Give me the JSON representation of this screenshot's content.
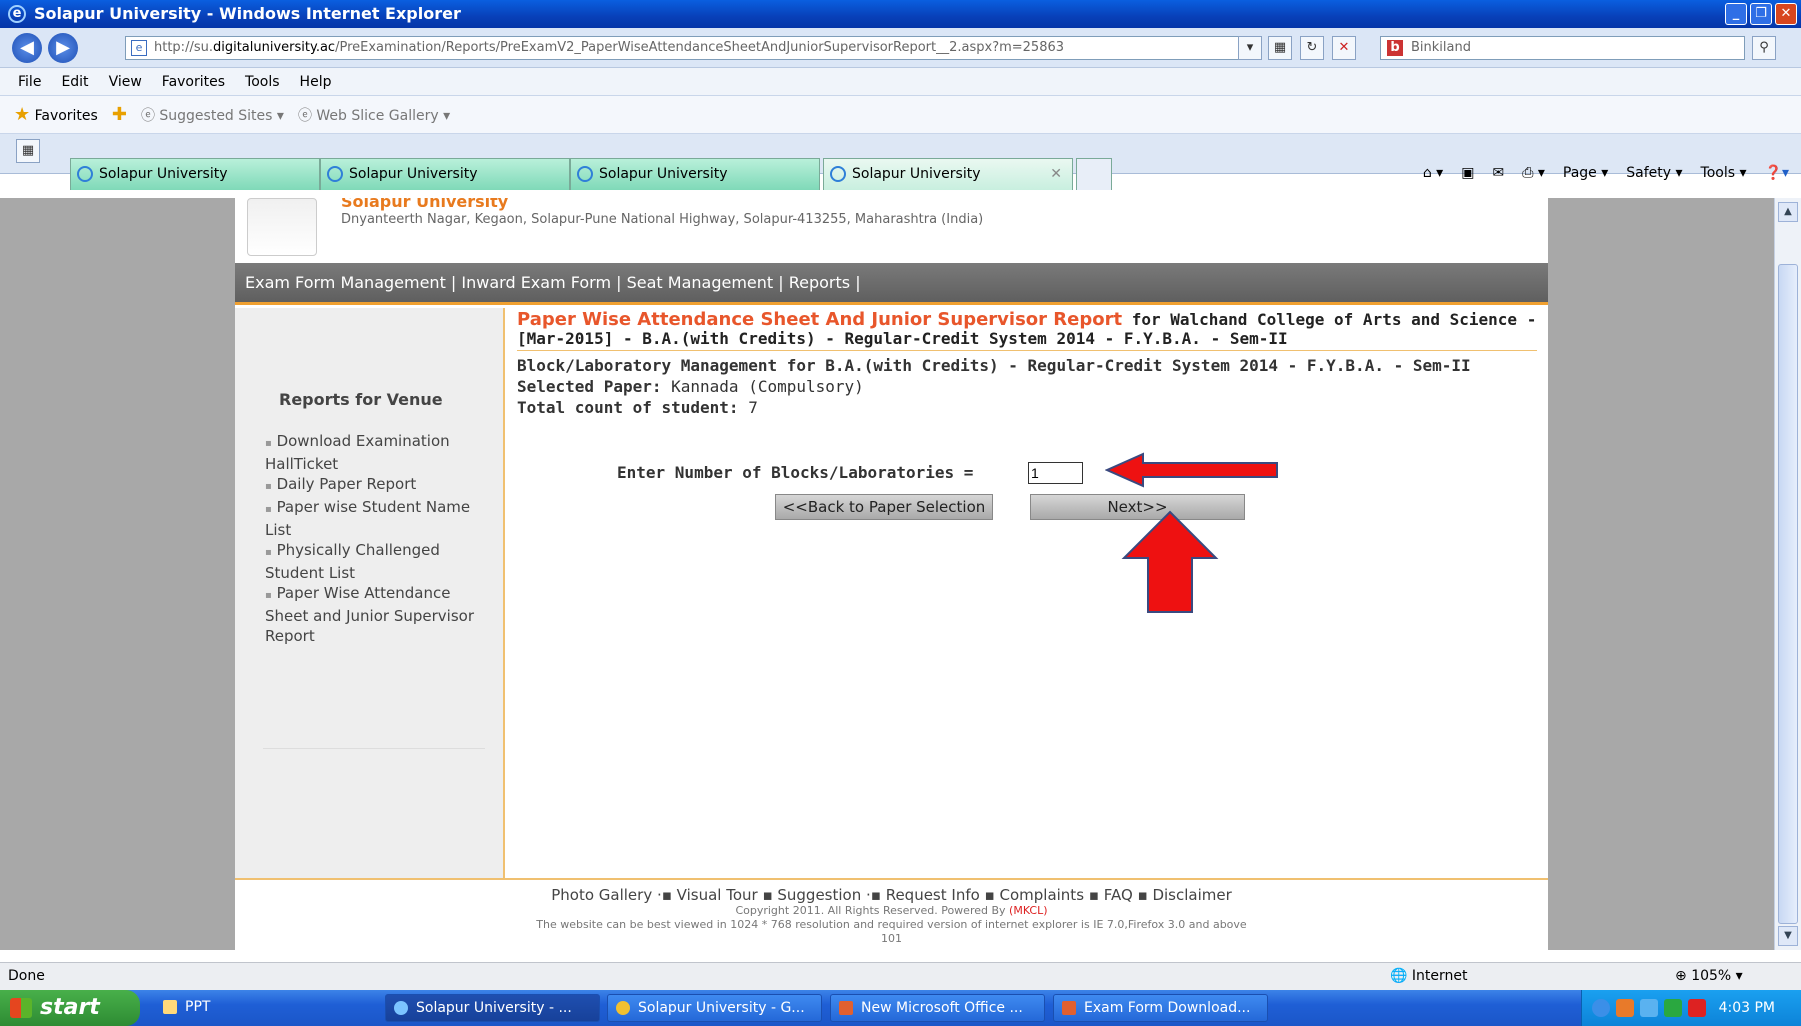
{
  "window": {
    "title": "Solapur University - Windows Internet Explorer"
  },
  "address": {
    "prefix": "http://su.",
    "domain": "digitaluniversity.ac",
    "path": "/PreExamination/Reports/PreExamV2_PaperWiseAttendanceSheetAndJuniorSupervisorReport__2.aspx?m=25863"
  },
  "search": {
    "placeholder": "Bing",
    "value": "Binkiland"
  },
  "menu": [
    "File",
    "Edit",
    "View",
    "Favorites",
    "Tools",
    "Help"
  ],
  "favbar": {
    "favorites": "Favorites",
    "suggested": "Suggested Sites",
    "webslice": "Web Slice Gallery"
  },
  "tabs": [
    "Solapur University",
    "Solapur University",
    "Solapur University",
    "Solapur University"
  ],
  "cmdbar": {
    "page": "Page",
    "safety": "Safety",
    "tools": "Tools"
  },
  "site": {
    "name": "Solapur University",
    "address": "Dnyanteerth Nagar, Kegaon, Solapur-Pune National Highway, Solapur-413255, Maharashtra (India)",
    "topnav": "Exam Form Management | Inward Exam Form | Seat Management | Reports |"
  },
  "sidebar": {
    "heading": "Reports for Venue",
    "items": [
      "Download Examination HallTicket",
      "Daily Paper Report",
      "Paper wise Student Name List",
      "Physically Challenged Student List",
      "Paper Wise Attendance Sheet and Junior Supervisor Report"
    ]
  },
  "main": {
    "title_orange": "Paper Wise Attendance Sheet And Junior Supervisor Report",
    "title_rest1": " for Walchand College of Arts and Science -",
    "title_rest2": "[Mar-2015] - B.A.(with Credits) - Regular-Credit System 2014 - F.Y.B.A. - Sem-II",
    "block_line": "Block/Laboratory Management for B.A.(with Credits) - Regular-Credit System 2014 - F.Y.B.A. - Sem-II",
    "selected_paper_label": "Selected Paper:",
    "selected_paper_value": " Kannada (Compulsory)",
    "total_label": "Total count of student:",
    "total_value": " 7",
    "blocks_label": "Enter Number of Blocks/Laboratories =",
    "blocks_value": "1",
    "back_button": "<<Back to Paper Selection",
    "next_button": "Next>>"
  },
  "footer": {
    "links": "Photo Gallery ·▪ Visual Tour ▪ Suggestion ·▪ Request Info ▪ Complaints ▪ FAQ ▪ Disclaimer",
    "copyright": "Copyright 2011. All Rights Reserved. Powered By ",
    "mkcl": "(MKCL)",
    "best_viewed": "The website can be best viewed in 1024 * 768 resolution and required version of internet explorer is IE 7.0,Firefox 3.0 and above",
    "code": "101"
  },
  "status": {
    "left": "Done",
    "zone": "Internet",
    "zoom": "105%"
  },
  "taskbar": {
    "start": "start",
    "items": [
      "PPT",
      "Solapur University - ...",
      "Solapur University - G...",
      "New Microsoft Office ...",
      "Exam Form Download..."
    ],
    "clock": "4:03 PM"
  },
  "colors": {
    "accent_orange": "#e8562b",
    "arrow_red": "#ee1111",
    "nav_gray": "#6d6d6d"
  }
}
